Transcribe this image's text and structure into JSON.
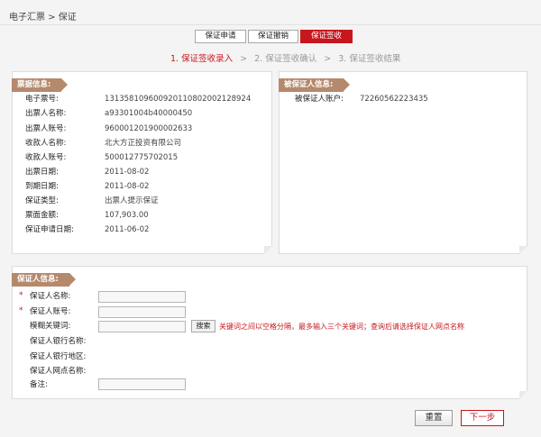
{
  "breadcrumb": "电子汇票 > 保证",
  "tabs": [
    {
      "label": "保证申请"
    },
    {
      "label": "保证撤销"
    },
    {
      "label": "保证签收"
    }
  ],
  "steps": [
    {
      "label": "1. 保证签收录入"
    },
    {
      "label": "2. 保证签收确认"
    },
    {
      "label": "3. 保证签收结果"
    }
  ],
  "step_separator": ">",
  "bill_info": {
    "title": "票据信息:",
    "rows": [
      {
        "label": "电子票号:",
        "value": "131358109600920110802002128924"
      },
      {
        "label": "出票人名称:",
        "value": "a93301004b40000450"
      },
      {
        "label": "出票人账号:",
        "value": "960001201900002633"
      },
      {
        "label": "收款人名称:",
        "value": "北大方正投资有限公司"
      },
      {
        "label": "收款人账号:",
        "value": "500012775702015"
      },
      {
        "label": "出票日期:",
        "value": "2011-08-02"
      },
      {
        "label": "到期日期:",
        "value": "2011-08-02"
      },
      {
        "label": "保证类型:",
        "value": "出票人提示保证"
      },
      {
        "label": "票面金额:",
        "value": "107,903.00"
      },
      {
        "label": "保证申请日期:",
        "value": "2011-06-02"
      }
    ]
  },
  "guaranteed": {
    "title": "被保证人信息:",
    "account_label": "被保证人账户:",
    "account_value": "72260562223435"
  },
  "guarantor": {
    "title": "保证人信息:",
    "name_label": "保证人名称:",
    "account_label": "保证人账号:",
    "keyword_label": "模糊关键词:",
    "search_label": "搜索",
    "hint": "关键词之间以空格分隔，最多输入三个关键词；查询后请选择保证人网点名称",
    "bank_name_label": "保证人银行名称:",
    "bank_region_label": "保证人银行地区:",
    "branch_label": "保证人网点名称:",
    "remark_label": "备注:",
    "required_mark": "*"
  },
  "buttons": {
    "reset": "重置",
    "next": "下一步"
  },
  "colors": {
    "accent": "#c8161d",
    "tag": "#b5896c"
  }
}
